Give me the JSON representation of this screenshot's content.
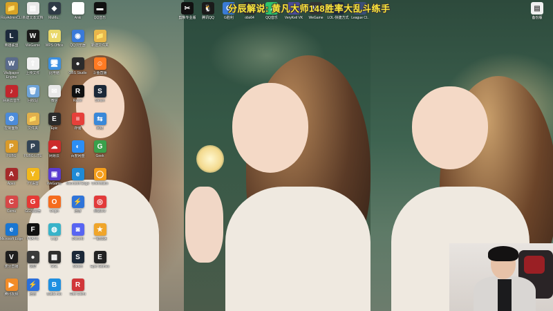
{
  "stream_banner": "分辰解说: 黄凡大师148胜率大乱斗练手",
  "left_icons": [
    {
      "label": "RoyAdminCLI",
      "glyph": "📁",
      "color": "#d8a326"
    },
    {
      "label": "新建文本文档",
      "glyph": "▤",
      "color": "#e9e9e9"
    },
    {
      "label": "MuMu..",
      "glyph": "◆",
      "color": "#2f3a46"
    },
    {
      "label": "Anki",
      "glyph": "✱",
      "color": "#ffffff"
    },
    {
      "label": "QQ音乐",
      "glyph": "▬",
      "color": "#111111"
    },
    {
      "label": "英雄联盟",
      "glyph": "L",
      "color": "#1d2a3c"
    },
    {
      "label": "WeGame",
      "glyph": "W",
      "color": "#1a1a1a"
    },
    {
      "label": "WPS Office",
      "glyph": "W",
      "color": "#e9d86b"
    },
    {
      "label": "QQ浏览器",
      "glyph": "◉",
      "color": "#3a7ad9"
    },
    {
      "label": "新建文件夹",
      "glyph": "📁",
      "color": "#e8b84a"
    },
    {
      "label": "Wallpaper Engine",
      "glyph": "W",
      "color": "#5a6b8b"
    },
    {
      "label": "上传文件",
      "glyph": "⇪",
      "color": "#f0f0f0"
    },
    {
      "label": "此电脑",
      "glyph": "🖥",
      "color": "#3c8fe0"
    },
    {
      "label": "OBS Studio",
      "glyph": "●",
      "color": "#2b2b2b"
    },
    {
      "label": "斗鱼直播",
      "glyph": "☺",
      "color": "#ff7a22"
    },
    {
      "label": "网易云音乐",
      "glyph": "♪",
      "color": "#c1272d"
    },
    {
      "label": "回收站",
      "glyph": "🗑",
      "color": "#6ea3d8"
    },
    {
      "label": "微信",
      "glyph": "✉",
      "color": "#e8e8e8"
    },
    {
      "label": "Razer",
      "glyph": "R",
      "color": "#111111"
    },
    {
      "label": "Steam",
      "glyph": "S",
      "color": "#1b2838"
    },
    {
      "label": "控制面板",
      "glyph": "⚙",
      "color": "#4c8bd9"
    },
    {
      "label": "文件夹",
      "glyph": "📁",
      "color": "#e0b04c"
    },
    {
      "label": "Epic",
      "glyph": "E",
      "color": "#2a2a2a"
    },
    {
      "label": "存储",
      "glyph": "≡",
      "color": "#e6403a"
    },
    {
      "label": "网络",
      "glyph": "⇆",
      "color": "#3a88d8"
    },
    {
      "label": "PUBG",
      "glyph": "P",
      "color": "#d99a2a"
    },
    {
      "label": "PUBG LITE",
      "glyph": "P",
      "color": "#334455"
    },
    {
      "label": "网易云",
      "glyph": "☁",
      "color": "#cc2b2b"
    },
    {
      "label": "百度网盘",
      "glyph": "◐",
      "color": "#2c8ef5"
    },
    {
      "label": "Geek",
      "glyph": "G",
      "color": "#3aa04b"
    },
    {
      "label": "Apex",
      "glyph": "A",
      "color": "#a52a2a"
    },
    {
      "label": "YY语音",
      "glyph": "Y",
      "color": "#f2b81b"
    },
    {
      "label": "WeGame",
      "glyph": "▣",
      "color": "#5a3ccf"
    },
    {
      "label": "Microsoft Edge",
      "glyph": "e",
      "color": "#1f8ad6"
    },
    {
      "label": "Overwatch",
      "glyph": "◯",
      "color": "#f59e1b"
    },
    {
      "label": "Cemu",
      "glyph": "C",
      "color": "#d64848"
    },
    {
      "label": "GG加速器",
      "glyph": "G",
      "color": "#e53935"
    },
    {
      "label": "Origin",
      "glyph": "O",
      "color": "#f56c1e"
    },
    {
      "label": "迅游",
      "glyph": "⚡",
      "color": "#2f74d9"
    },
    {
      "label": "网易UU",
      "glyph": "◎",
      "color": "#e23a3a"
    },
    {
      "label": "Microsoft Edge",
      "glyph": "e",
      "color": "#1976d2"
    },
    {
      "label": "FNATIC",
      "glyph": "F",
      "color": "#111111"
    },
    {
      "label": "Logi",
      "glyph": "◍",
      "color": "#38b3c9"
    },
    {
      "label": "Discord",
      "glyph": "◙",
      "color": "#5865f2"
    },
    {
      "label": "一键加速",
      "glyph": "★",
      "color": "#f0a52a"
    },
    {
      "label": "虎牙直播",
      "glyph": "V",
      "color": "#1e1e1e"
    },
    {
      "label": "录屏",
      "glyph": "●",
      "color": "#3b3b3b"
    },
    {
      "label": "GGL",
      "glyph": "▩",
      "color": "#2e2e2e"
    },
    {
      "label": "Steam",
      "glyph": "S",
      "color": "#1b2838"
    },
    {
      "label": "Epic Games",
      "glyph": "E",
      "color": "#222222"
    },
    {
      "label": "腾讯视频",
      "glyph": "▶",
      "color": "#f28c28"
    },
    {
      "label": "迅雷",
      "glyph": "⚡",
      "color": "#2a6fdb"
    },
    {
      "label": "Battle.net",
      "glyph": "B",
      "color": "#1e8fe1"
    },
    {
      "label": "Riot Client",
      "glyph": "R",
      "color": "#d13639"
    }
  ],
  "top_icons": [
    {
      "label": "剪映专业版",
      "glyph": "✂",
      "color": "#111111"
    },
    {
      "label": "腾讯QQ",
      "glyph": "🐧",
      "color": "#1a1a1a"
    },
    {
      "label": "G胜利",
      "glyph": "G",
      "color": "#3a7bd5"
    },
    {
      "label": "obs64",
      "glyph": "●",
      "color": "#2b2b2b"
    },
    {
      "label": "QQ音乐",
      "glyph": "♪",
      "color": "#2ec26a"
    },
    {
      "label": "VeryKeil VK",
      "glyph": "V",
      "color": "#4a4a9a"
    },
    {
      "label": "WeGame",
      "glyph": "W",
      "color": "#333333"
    },
    {
      "label": "LOL-快捷方式",
      "glyph": "L",
      "color": "#1d2a3c"
    },
    {
      "label": "League Cl..",
      "glyph": "L",
      "color": "#3b4f7a"
    }
  ],
  "right_icon": {
    "label": "备份版",
    "glyph": "▤",
    "color": "#f0f0f0"
  }
}
